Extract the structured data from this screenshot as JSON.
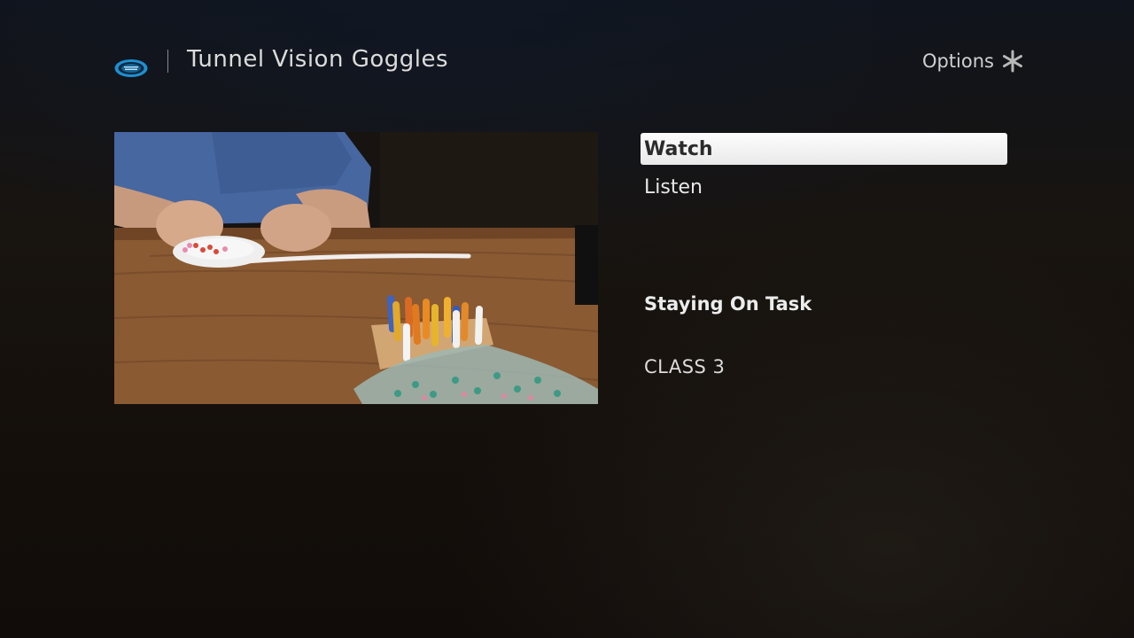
{
  "header": {
    "logo_icon": "tunnel-vision-eye-logo",
    "logo_color": "#1f8fd0",
    "title": "Tunnel Vision Goggles",
    "options_label": "Options",
    "options_icon": "asterisk-icon"
  },
  "thumbnail": {
    "alt": "Child playing with colorful pegs and a pegboard at a wooden table"
  },
  "menu": {
    "items": [
      {
        "label": "Watch",
        "selected": true
      },
      {
        "label": "Listen",
        "selected": false
      }
    ]
  },
  "episode": {
    "title": "Staying On Task",
    "subtitle": "CLASS 3"
  },
  "colors": {
    "selection_background": "#f4f4f4",
    "selection_text": "#2b2b2b",
    "text": "#e8e8e8"
  }
}
